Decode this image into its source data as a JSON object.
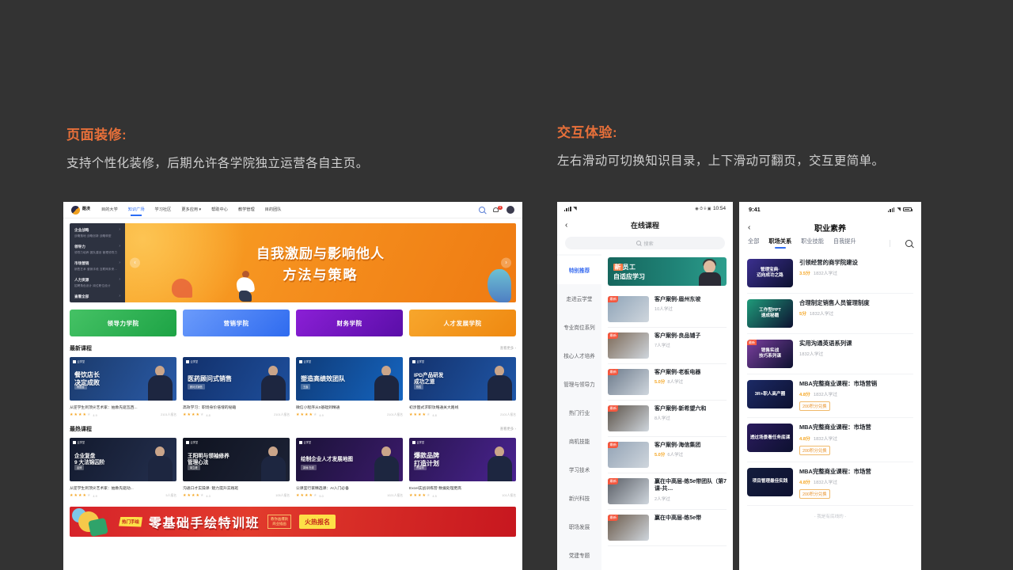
{
  "sections": {
    "left": {
      "title": "页面装修:",
      "desc": "支持个性化装修，后期允许各学院独立运营各自主页。"
    },
    "right": {
      "title": "交互体验:",
      "desc": "左右滑动可切换知识目录，上下滑动可翻页，交互更简单。"
    }
  },
  "web": {
    "logo": {
      "name": "酷渼",
      "sub": "KUMEI ONLINE"
    },
    "nav": [
      {
        "label": "目的大学"
      },
      {
        "label": "知识广场",
        "active": true
      },
      {
        "label": "学习社区"
      },
      {
        "label": "更多应用 ▾"
      },
      {
        "label": "帮助中心"
      },
      {
        "label": "教学管理"
      },
      {
        "label": "目的团队"
      }
    ],
    "nav_icons": {
      "search": "search-icon",
      "bell": "bell-icon",
      "bell_badge": "9",
      "avatar": "avatar-icon"
    },
    "banner": {
      "menu": [
        {
          "title": "企业战略",
          "sub": "战略落地  战略创新  战略转型"
        },
        {
          "title": "领导力",
          "sub": "领导力培养  团队建设  管理领导力"
        },
        {
          "title": "市场营销",
          "sub": "销售艺术  营销手段  互联网未来..."
        },
        {
          "title": "人力资源",
          "sub": "招聘角色设计  岗位职位设计"
        },
        {
          "title": "查看全部",
          "sub": ""
        }
      ],
      "title_line1": "自我激励与影响他人",
      "title_line2": "方法与策略",
      "prev": "‹",
      "next": "›"
    },
    "academies": [
      {
        "label": "领导力学院"
      },
      {
        "label": "营销学院"
      },
      {
        "label": "财务学院"
      },
      {
        "label": "人才发展学院"
      }
    ],
    "sections_list": [
      {
        "title": "最新课程",
        "more": "查看更多 ›",
        "cards": [
          {
            "brand": "云学堂",
            "img_title": "餐饮店长\n决定成败",
            "pill": "杨国金",
            "title": "从逆学生到顶尖艺术家：抽象先驱瓦西...",
            "stars": 4,
            "score": "4.9",
            "learners": "2101人报名"
          },
          {
            "brand": "云学堂",
            "img_title": "医药顾问式销售",
            "pill": "顾问式销售",
            "title": "高效学习：职场身价倍增的秘籍",
            "stars": 4,
            "score": "4.8",
            "learners": "2101人报名"
          },
          {
            "brand": "云学堂",
            "img_title": "塑造高绩效团队",
            "pill": "王鑫",
            "title": "微信小程序从0基础到精通",
            "stars": 4,
            "score": "4.9",
            "learners": "2101人报名"
          },
          {
            "brand": "云学堂",
            "img_title": "IPD产品研发\n成功之道",
            "pill": "陈胜",
            "title": "初涉图式求职攻略通关大路线",
            "stars": 4,
            "score": "4.8",
            "learners": "2101人报名"
          }
        ]
      },
      {
        "title": "最热课程",
        "more": "查看更多 ›",
        "cards": [
          {
            "brand": "云学堂",
            "img_title": "企业复盘\n9 大法锦囚阶",
            "pill": "孟博",
            "title": "从逆学生到顶尖艺术家：抽象先驱动...",
            "stars": 4,
            "score": "4.9",
            "learners": "5人报名"
          },
          {
            "brand": "云学堂",
            "img_title": "王阳明与领袖修养\n管理心法",
            "pill": "胡立峰",
            "title": "沟通口才实操课· 魅力提升实践班",
            "stars": 4,
            "score": "4.3",
            "learners": "105人报名"
          },
          {
            "brand": "云学堂",
            "img_title": "绘制企业人才发展地图",
            "pill": "郭涛 在线",
            "title": "公课室行家精选课：AI入门必备",
            "stars": 4,
            "score": "5.0",
            "learners": "1021人报名"
          },
          {
            "brand": "云学堂",
            "img_title": "爆款品牌\n打造计划",
            "pill": "曹智刚",
            "title": "Excel实战训练营·数据处理更高",
            "stars": 4,
            "score": "4.5",
            "learners": "101人报名"
          }
        ]
      }
    ],
    "red_banner": {
      "tag": "热门手绘",
      "main": "零基础手绘特训班",
      "note_line1": "教你画爆款",
      "note_line2": "商业插画",
      "cta": "火热报名"
    }
  },
  "phone1": {
    "status": {
      "time": "10:54",
      "carrier_icons": "signal-wifi-icons"
    },
    "back": "‹",
    "title": "在线课程",
    "search_placeholder": "搜索",
    "categories": [
      {
        "label": "特别推荐",
        "active": true
      },
      {
        "label": "走进云学堂"
      },
      {
        "label": "专业岗位系列"
      },
      {
        "label": "核心人才培养"
      },
      {
        "label": "管理与领导力"
      },
      {
        "label": "热门行业"
      },
      {
        "label": "商机技能"
      },
      {
        "label": "学习技术"
      },
      {
        "label": "新兴科技"
      },
      {
        "label": "职场发展"
      },
      {
        "label": "党建专题"
      }
    ],
    "promo": {
      "line1_a": "新",
      "line1_b": "员工",
      "line2": "自适应学习"
    },
    "items": [
      {
        "badge": "最新",
        "name": "客户案例-眉州东坡",
        "score": "",
        "learners": "10人学过",
        "thumb": "#8fa4b8"
      },
      {
        "badge": "最新",
        "name": "客户案例-良品铺子",
        "score": "",
        "learners": "7人学过",
        "thumb": "#7d6a58"
      },
      {
        "badge": "最新",
        "name": "客户案例-老板电器",
        "score": "5.0分",
        "learners": "8人学过",
        "thumb": "#6d7b8c"
      },
      {
        "badge": "最新",
        "name": "客户案例-新希望六和",
        "score": "",
        "learners": "8人学过",
        "thumb": "#5c5248"
      },
      {
        "badge": "最新",
        "name": "客户案例-海信集团",
        "score": "5.0分",
        "learners": "6人学过",
        "thumb": "#93a3b5"
      },
      {
        "badge": "最新",
        "name": "赢在中高层-练5e带团队（第7课-共…",
        "score": "",
        "learners": "2人学过",
        "thumb": "#5a5e66"
      },
      {
        "badge": "最新",
        "name": "赢在中高层-练5e带",
        "score": "",
        "learners": "",
        "thumb": "#6b5a4a"
      }
    ]
  },
  "phone2": {
    "status": {
      "time": "9:41",
      "icons": "signal-wifi-battery"
    },
    "back": "‹",
    "title": "职业素养",
    "tabs": [
      {
        "label": "全部"
      },
      {
        "label": "职场关系",
        "active": true
      },
      {
        "label": "职业技能"
      },
      {
        "label": "自我提升"
      }
    ],
    "search_icon": "search-icon",
    "items": [
      {
        "thumb_text": "管理宝典·\n迈向成功之路",
        "thumb_color": "#3b2f8f",
        "badge": "",
        "name": "引领经营的商学院建设",
        "score": "3.5分",
        "learners": "1832人学过",
        "points": ""
      },
      {
        "thumb_text": "工作型PPT\n速成秘籍",
        "thumb_color": "#1f9b7a",
        "badge": "",
        "name": "合理制定销售人员管理制度",
        "score": "5分",
        "learners": "1832人学过",
        "points": ""
      },
      {
        "thumb_text": "销售实战\n技巧系列课",
        "thumb_color": "#7a3f9e",
        "badge": "最新",
        "name": "实用沟通英语系列课",
        "score": "",
        "learners": "1832人学过",
        "points": ""
      },
      {
        "thumb_text": "3R+职人高产圈",
        "thumb_color": "#1c2a66",
        "badge": "",
        "name": "MBA完整商业课程：市场营销",
        "score": "4.8分",
        "learners": "1832人学过",
        "points": "200积分兑换"
      },
      {
        "thumb_text": "透过场景看任务底课",
        "thumb_color": "#2b1b5e",
        "badge": "",
        "name": "MBA完整商业课程：市场营",
        "score": "4.8分",
        "learners": "1832人学过",
        "points": "200积分兑换"
      },
      {
        "thumb_text": "项目管理最佳实践",
        "thumb_color": "#141d3d",
        "badge": "",
        "name": "MBA完整商业课程：市场营",
        "score": "4.8分",
        "learners": "1832人学过",
        "points": "200积分兑换"
      }
    ],
    "footer": "- 我是有底线的 -"
  }
}
